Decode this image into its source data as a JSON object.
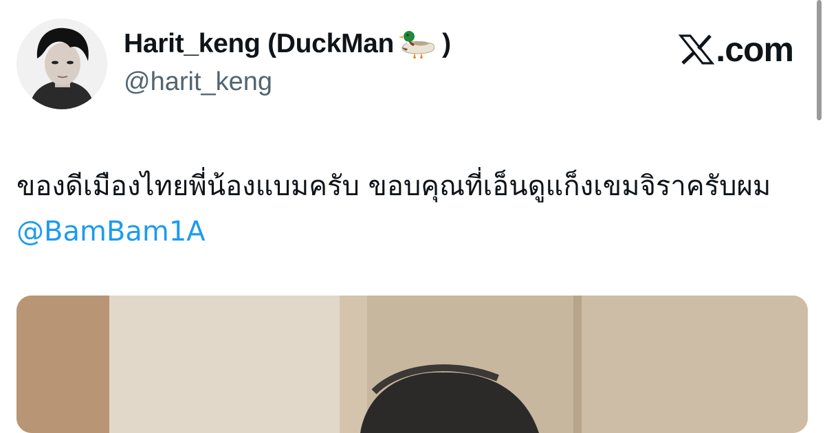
{
  "post": {
    "author": {
      "display_name": "Harit_keng (DuckMan",
      "emoji_icon": "mallard-duck-icon",
      "closing_paren": ")",
      "handle": "@harit_keng"
    },
    "brand": {
      "logo_icon": "x-logo-icon",
      "text": ".com"
    },
    "text": {
      "body": "ของดีเมืองไทยพี่น้องแบมครับ ขอบคุณที่เอ็นดูแก็งเขมจิราครับผม",
      "mention": "@BamBam1A"
    }
  },
  "colors": {
    "text": "#0f1419",
    "secondary": "#536471",
    "link": "#1d9bf0"
  }
}
